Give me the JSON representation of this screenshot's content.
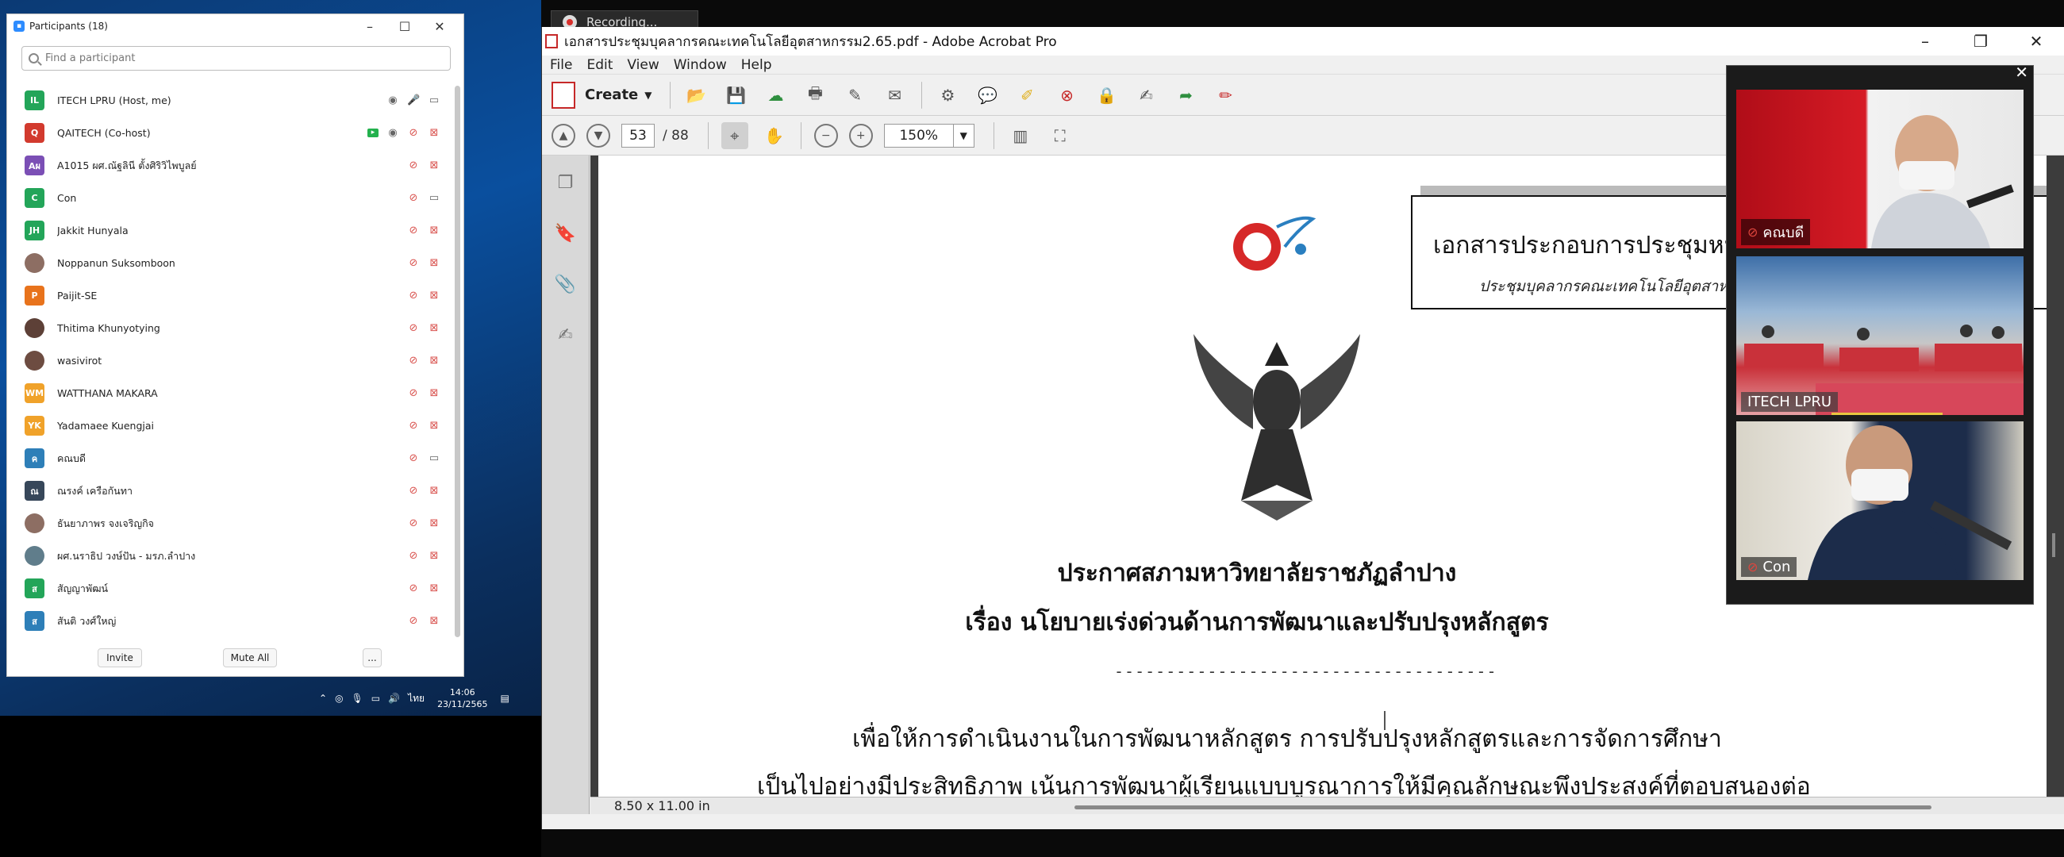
{
  "participants": {
    "title": "Participants (18)",
    "search_placeholder": "Find a participant",
    "rows": [
      {
        "initials": "IL",
        "color": "#23a559",
        "name": "ITECH LPRU (Host, me)",
        "mic": "on",
        "cam": "on",
        "share": false,
        "photo": false
      },
      {
        "initials": "Q",
        "color": "#d23a2e",
        "name": "QAITECH (Co-host)",
        "mic": "off",
        "cam": "off",
        "share": true,
        "photo": false
      },
      {
        "initials": "Aผ",
        "color": "#7b4fb5",
        "name": "A1015 ผศ.ณัฐลินี ตั้งศิริวิไพบูลย์",
        "mic": "off",
        "cam": "off",
        "share": false,
        "photo": false
      },
      {
        "initials": "C",
        "color": "#23a559",
        "name": "Con",
        "mic": "off",
        "cam": "on",
        "share": false,
        "photo": false
      },
      {
        "initials": "JH",
        "color": "#23a559",
        "name": "Jakkit Hunyala",
        "mic": "off",
        "cam": "off",
        "share": false,
        "photo": false
      },
      {
        "initials": "",
        "color": "#8d6e63",
        "name": "Noppanun Suksomboon",
        "mic": "off",
        "cam": "off",
        "share": false,
        "photo": true
      },
      {
        "initials": "P",
        "color": "#e8731c",
        "name": "Paijit-SE",
        "mic": "off",
        "cam": "off",
        "share": false,
        "photo": false
      },
      {
        "initials": "",
        "color": "#5d4037",
        "name": "Thitima Khunyotying",
        "mic": "off",
        "cam": "off",
        "share": false,
        "photo": true
      },
      {
        "initials": "",
        "color": "#6d4c41",
        "name": "wasivirot",
        "mic": "off",
        "cam": "off",
        "share": false,
        "photo": true
      },
      {
        "initials": "WM",
        "color": "#f0a22a",
        "name": "WATTHANA MAKARA",
        "mic": "off",
        "cam": "off",
        "share": false,
        "photo": false
      },
      {
        "initials": "YK",
        "color": "#f0a22a",
        "name": "Yadamaee Kuengjai",
        "mic": "off",
        "cam": "off",
        "share": false,
        "photo": false
      },
      {
        "initials": "ค",
        "color": "#2e7fb8",
        "name": "คณบดี",
        "mic": "off",
        "cam": "on",
        "share": false,
        "photo": false
      },
      {
        "initials": "ณ",
        "color": "#37475a",
        "name": "ณรงค์ เครือกันทา",
        "mic": "off",
        "cam": "off",
        "share": false,
        "photo": false
      },
      {
        "initials": "",
        "color": "#8d6e63",
        "name": "ธันยาภาพร จงเจริญกิจ",
        "mic": "off",
        "cam": "off",
        "share": false,
        "photo": true
      },
      {
        "initials": "",
        "color": "#607d8b",
        "name": "ผศ.นราธิป วงษ์ปัน - มรภ.ลำปาง",
        "mic": "off",
        "cam": "off",
        "share": false,
        "photo": true
      },
      {
        "initials": "ส",
        "color": "#23a559",
        "name": "สัญญาพัฒน์",
        "mic": "off",
        "cam": "off",
        "share": false,
        "photo": false
      },
      {
        "initials": "ส",
        "color": "#2e7fb8",
        "name": "สันติ วงศ์ใหญ่",
        "mic": "off",
        "cam": "off",
        "share": false,
        "photo": false
      }
    ],
    "invite_label": "Invite",
    "mute_all_label": "Mute All",
    "more_label": "..."
  },
  "tray": {
    "lang": "ไทย",
    "time": "14:06",
    "date": "23/11/2565"
  },
  "recording": {
    "label": "Recording..."
  },
  "acrobat": {
    "title": "เอกสารประชุมบุคลากรคณะเทคโนโลยีอุตสาหกรรม2.65.pdf - Adobe Acrobat Pro",
    "menu": [
      "File",
      "Edit",
      "View",
      "Window",
      "Help"
    ],
    "create_label": "Create",
    "page_current": "53",
    "page_total": "/ 88",
    "zoom": "150%",
    "status_size": "8.50 x 11.00 in"
  },
  "document": {
    "header_title": "เอกสารประกอบการประชุมหม",
    "header_subtitle": "ประชุมบุคลากรคณะเทคโนโลยีอุตสาหกร",
    "title_line1": "ประกาศสภามหาวิทยาลัยราชภัฏลำปาง",
    "title_line2": "เรื่อง นโยบายเร่งด่วนด้านการพัฒนาและปรับปรุงหลักสูตร",
    "dash_line": "-------------------------------------",
    "para_line1": "เพื่อให้การดำเนินงานในการพัฒนาหลักสูตร การปรับปรุงหลักสูตรและการจัดการศึกษา",
    "para_line2": "เป็นไปอย่างมีประสิทธิภาพ เน้นการพัฒนาผู้เรียนแบบบูรณาการให้มีคุณลักษณะพึงประสงค์ที่ตอบสนองต่อ"
  },
  "video": {
    "tiles": [
      {
        "name": "คณบดี",
        "muted": true
      },
      {
        "name": "ITECH LPRU",
        "muted": false
      },
      {
        "name": "Con",
        "muted": true
      }
    ]
  }
}
